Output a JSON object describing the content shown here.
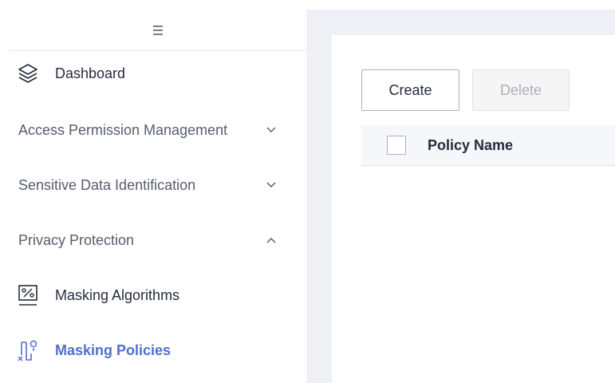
{
  "sidebar": {
    "collapse_icon": "hamburger-icon",
    "items": [
      {
        "label": "Dashboard",
        "icon": "layers-icon"
      },
      {
        "label": "Access Permission Management",
        "icon": "chevron-down-icon"
      },
      {
        "label": "Sensitive Data Identification",
        "icon": "chevron-down-icon"
      },
      {
        "label": "Privacy Protection",
        "icon": "chevron-up-icon"
      },
      {
        "label": "Masking Algorithms",
        "icon": "percent-box-icon"
      },
      {
        "label": "Masking Policies",
        "icon": "masking-policy-icon"
      }
    ],
    "active_item": "Masking Policies"
  },
  "toolbar": {
    "create_label": "Create",
    "delete_label": "Delete"
  },
  "table": {
    "columns": [
      "Policy Name"
    ]
  },
  "colors": {
    "accent": "#526ecc",
    "main_background": "#eef0f5",
    "table_header_background": "#f5f7fb"
  }
}
